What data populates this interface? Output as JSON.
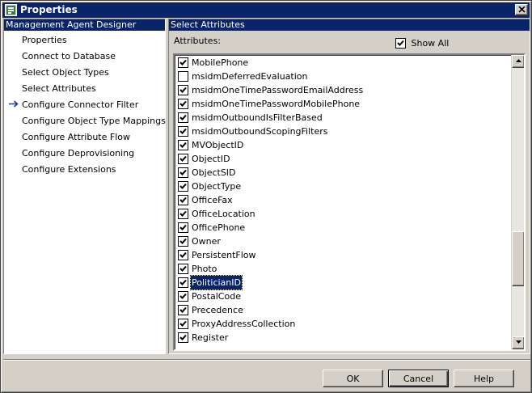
{
  "window": {
    "title": "Properties"
  },
  "left_panel": {
    "header": "Management Agent Designer",
    "items": [
      {
        "label": "Properties",
        "active": false
      },
      {
        "label": "Connect to Database",
        "active": false
      },
      {
        "label": "Select Object Types",
        "active": false
      },
      {
        "label": "Select Attributes",
        "active": true
      },
      {
        "label": "Configure Connector Filter",
        "active": false
      },
      {
        "label": "Configure Object Type Mappings",
        "active": false
      },
      {
        "label": "Configure Attribute Flow",
        "active": false
      },
      {
        "label": "Configure Deprovisioning",
        "active": false
      },
      {
        "label": "Configure Extensions",
        "active": false
      }
    ]
  },
  "right_panel": {
    "header": "Select Attributes",
    "attributes_label": "Attributes:",
    "show_all": {
      "label": "Show All",
      "checked": true
    },
    "attributes": [
      {
        "name": "MobilePhone",
        "checked": true
      },
      {
        "name": "msidmDeferredEvaluation",
        "checked": false
      },
      {
        "name": "msidmOneTimePasswordEmailAddress",
        "checked": true
      },
      {
        "name": "msidmOneTimePasswordMobilePhone",
        "checked": true
      },
      {
        "name": "msidmOutboundIsFilterBased",
        "checked": true
      },
      {
        "name": "msidmOutboundScopingFilters",
        "checked": true
      },
      {
        "name": "MVObjectID",
        "checked": true
      },
      {
        "name": "ObjectID",
        "checked": true
      },
      {
        "name": "ObjectSID",
        "checked": true
      },
      {
        "name": "ObjectType",
        "checked": true
      },
      {
        "name": "OfficeFax",
        "checked": true
      },
      {
        "name": "OfficeLocation",
        "checked": true
      },
      {
        "name": "OfficePhone",
        "checked": true
      },
      {
        "name": "Owner",
        "checked": true
      },
      {
        "name": "PersistentFlow",
        "checked": true
      },
      {
        "name": "Photo",
        "checked": true
      },
      {
        "name": "PoliticianID",
        "checked": true,
        "selected": true
      },
      {
        "name": "PostalCode",
        "checked": true
      },
      {
        "name": "Precedence",
        "checked": true
      },
      {
        "name": "ProxyAddressCollection",
        "checked": true
      },
      {
        "name": "Register",
        "checked": true
      }
    ]
  },
  "buttons": {
    "ok": "OK",
    "cancel": "Cancel",
    "help": "Help"
  },
  "icons": {
    "app": "properties-app-icon",
    "close": "close-icon",
    "current_step": "arrow-right-icon",
    "scroll_up": "scroll-up-arrow-icon",
    "scroll_down": "scroll-down-arrow-icon",
    "checkmark": "checkmark-icon"
  },
  "colors": {
    "title_bar": "#0a246a",
    "face": "#d4d0c8",
    "selection": "#0a246a",
    "arrow": "#1f3a93"
  }
}
